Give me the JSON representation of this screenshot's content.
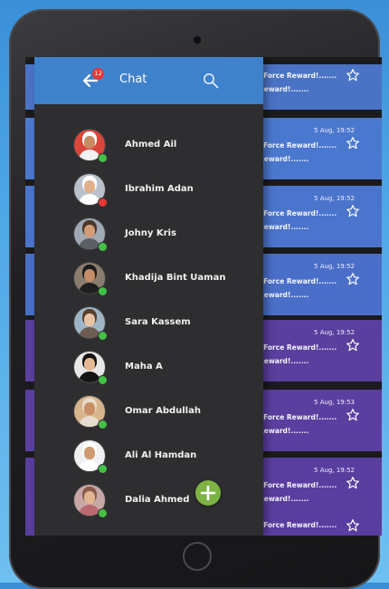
{
  "header": {
    "title": "Chat",
    "badge_count": "12"
  },
  "contacts": [
    {
      "name": "Ahmed Ail",
      "status": "online",
      "skin": "#c98a62",
      "bg": "#d9463c",
      "shirt": "#f2f2f2",
      "hair": "#ffffff"
    },
    {
      "name": "Ibrahim Adan",
      "status": "busy",
      "skin": "#e0b08b",
      "bg": "#b9c2cc",
      "shirt": "#ffffff",
      "hair": "#ffffff"
    },
    {
      "name": "Johny Kris",
      "status": "online",
      "skin": "#d29c78",
      "bg": "#9fa8b3",
      "shirt": "#5b5f66",
      "hair": "#4a3628"
    },
    {
      "name": "Khadija Bint Uaman",
      "status": "online",
      "skin": "#c48d6a",
      "bg": "#8b7d6e",
      "shirt": "#1f1f1f",
      "hair": "#1c1c1c"
    },
    {
      "name": "Sara Kassem",
      "status": "online",
      "skin": "#e7c3a6",
      "bg": "#9fb5c6",
      "shirt": "#6d5c52",
      "hair": "#5a3f2d"
    },
    {
      "name": "Maha A",
      "status": "online",
      "skin": "#e4b894",
      "bg": "#e8e8e8",
      "shirt": "#141414",
      "hair": "#141414"
    },
    {
      "name": "Omar Abdullah",
      "status": "online",
      "skin": "#c98d64",
      "bg": "#d6b48c",
      "shirt": "#e6dccf",
      "hair": "#e7dbc9"
    },
    {
      "name": "Ali Al Hamdan",
      "status": "online",
      "skin": "#cf9a73",
      "bg": "#eef0f2",
      "shirt": "#ffffff",
      "hair": "#ffffff"
    },
    {
      "name": "Dalia Ahmed",
      "status": "online",
      "skin": "#e1b592",
      "bg": "#c8a7a7",
      "shirt": "#b86a70",
      "hair": "#8a5a4a"
    }
  ],
  "messages": [
    {
      "time": "",
      "line1": "eForce Reward!.......",
      "line2": "Reward!.......",
      "color": "#4a73c6"
    },
    {
      "time": "5 Aug, 19:52",
      "line1": "eForce Reward!.......",
      "line2": "Reward!.......",
      "color": "#4b78cf"
    },
    {
      "time": "5 Aug, 19:52",
      "line1": "eForce Reward!.......",
      "line2": "Reward!.......",
      "color": "#4b74cc"
    },
    {
      "time": "5 Aug, 19:52",
      "line1": "eForce Reward!.......",
      "line2": "Reward!.......",
      "color": "#4a6fc9"
    },
    {
      "time": "5 Aug, 19:52",
      "line1": "eForce Reward!.......",
      "line2": "Reward!.......",
      "color": "#5a3f9e"
    },
    {
      "time": "5 Aug, 19:53",
      "line1": "eForce Reward!.......",
      "line2": "Reward!.......",
      "color": "#5b3fa0"
    },
    {
      "time": "5 Aug, 19:52",
      "line1": "eForce Reward!.......",
      "line2": "Reward!.......",
      "color": "#5a3e9f"
    },
    {
      "time": "",
      "line1": "eForce Reward!.......",
      "line2": "",
      "color": "#5a3e9f"
    }
  ],
  "colors": {
    "header": "#3e82cc",
    "drawer": "#2e2e30",
    "online": "#43c045",
    "busy": "#e53935",
    "fab": "#7cb342"
  },
  "icons": {
    "back": "arrow-left-icon",
    "search": "search-icon",
    "star": "star-outline-icon",
    "add": "plus-icon"
  }
}
